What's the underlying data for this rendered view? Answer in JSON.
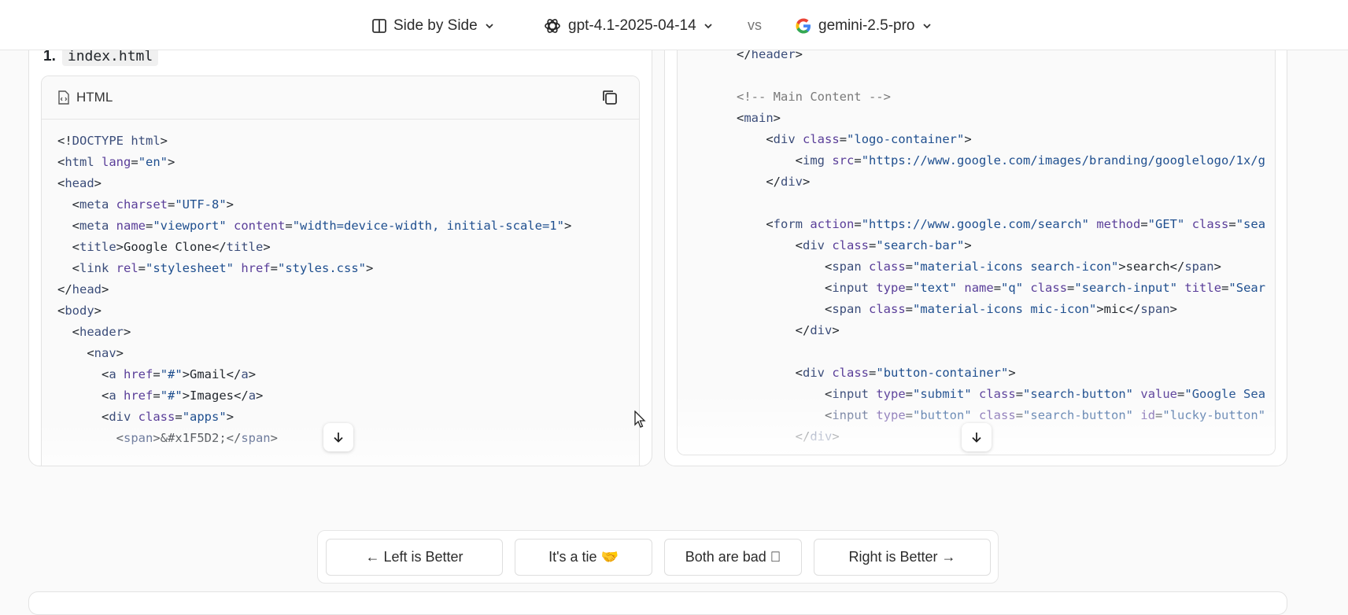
{
  "topbar": {
    "view_mode": "Side by Side",
    "left_model": "gpt-4.1-2025-04-14",
    "vs": "vs",
    "right_model": "gemini-2.5-pro"
  },
  "left_panel": {
    "file_number": "1.",
    "file_name": "index.html",
    "language": "HTML",
    "code_lines": [
      [
        [
          "p",
          "<!"
        ],
        [
          "t",
          "DOCTYPE html"
        ],
        [
          "p",
          ">"
        ]
      ],
      [
        [
          "p",
          "<"
        ],
        [
          "t",
          "html"
        ],
        [
          "p",
          " "
        ],
        [
          "a",
          "lang"
        ],
        [
          "p",
          "="
        ],
        [
          "s",
          "\"en\""
        ],
        [
          "p",
          ">"
        ]
      ],
      [
        [
          "p",
          "<"
        ],
        [
          "t",
          "head"
        ],
        [
          "p",
          ">"
        ]
      ],
      [
        [
          "p",
          "  <"
        ],
        [
          "t",
          "meta"
        ],
        [
          "p",
          " "
        ],
        [
          "a",
          "charset"
        ],
        [
          "p",
          "="
        ],
        [
          "s",
          "\"UTF-8\""
        ],
        [
          "p",
          ">"
        ]
      ],
      [
        [
          "p",
          "  <"
        ],
        [
          "t",
          "meta"
        ],
        [
          "p",
          " "
        ],
        [
          "a",
          "name"
        ],
        [
          "p",
          "="
        ],
        [
          "s",
          "\"viewport\""
        ],
        [
          "p",
          " "
        ],
        [
          "a",
          "content"
        ],
        [
          "p",
          "="
        ],
        [
          "s",
          "\"width=device-width, initial-scale=1\""
        ],
        [
          "p",
          ">"
        ]
      ],
      [
        [
          "p",
          "  <"
        ],
        [
          "t",
          "title"
        ],
        [
          "p",
          ">Google Clone</"
        ],
        [
          "t",
          "title"
        ],
        [
          "p",
          ">"
        ]
      ],
      [
        [
          "p",
          "  <"
        ],
        [
          "t",
          "link"
        ],
        [
          "p",
          " "
        ],
        [
          "a",
          "rel"
        ],
        [
          "p",
          "="
        ],
        [
          "s",
          "\"stylesheet\""
        ],
        [
          "p",
          " "
        ],
        [
          "a",
          "href"
        ],
        [
          "p",
          "="
        ],
        [
          "s",
          "\"styles.css\""
        ],
        [
          "p",
          ">"
        ]
      ],
      [
        [
          "p",
          "</"
        ],
        [
          "t",
          "head"
        ],
        [
          "p",
          ">"
        ]
      ],
      [
        [
          "p",
          "<"
        ],
        [
          "t",
          "body"
        ],
        [
          "p",
          ">"
        ]
      ],
      [
        [
          "p",
          "  <"
        ],
        [
          "t",
          "header"
        ],
        [
          "p",
          ">"
        ]
      ],
      [
        [
          "p",
          "    <"
        ],
        [
          "t",
          "nav"
        ],
        [
          "p",
          ">"
        ]
      ],
      [
        [
          "p",
          "      <"
        ],
        [
          "t",
          "a"
        ],
        [
          "p",
          " "
        ],
        [
          "a",
          "href"
        ],
        [
          "p",
          "="
        ],
        [
          "s",
          "\"#\""
        ],
        [
          "p",
          ">Gmail</"
        ],
        [
          "t",
          "a"
        ],
        [
          "p",
          ">"
        ]
      ],
      [
        [
          "p",
          "      <"
        ],
        [
          "t",
          "a"
        ],
        [
          "p",
          " "
        ],
        [
          "a",
          "href"
        ],
        [
          "p",
          "="
        ],
        [
          "s",
          "\"#\""
        ],
        [
          "p",
          ">Images</"
        ],
        [
          "t",
          "a"
        ],
        [
          "p",
          ">"
        ]
      ],
      [
        [
          "p",
          "      <"
        ],
        [
          "t",
          "div"
        ],
        [
          "p",
          " "
        ],
        [
          "a",
          "class"
        ],
        [
          "p",
          "="
        ],
        [
          "s",
          "\"apps\""
        ],
        [
          "p",
          ">"
        ]
      ],
      [
        [
          "p",
          "        <"
        ],
        [
          "t",
          "span"
        ],
        [
          "p",
          ">&#x1F5D2;</"
        ],
        [
          "t",
          "span"
        ],
        [
          "p",
          ">"
        ]
      ]
    ]
  },
  "right_panel": {
    "code_lines": [
      [
        [
          "p",
          "</"
        ],
        [
          "t",
          "header"
        ],
        [
          "p",
          ">"
        ]
      ],
      [
        [
          "p",
          ""
        ]
      ],
      [
        [
          "c",
          "<!-- Main Content -->"
        ]
      ],
      [
        [
          "p",
          "<"
        ],
        [
          "t",
          "main"
        ],
        [
          "p",
          ">"
        ]
      ],
      [
        [
          "p",
          "    <"
        ],
        [
          "t",
          "div"
        ],
        [
          "p",
          " "
        ],
        [
          "a",
          "class"
        ],
        [
          "p",
          "="
        ],
        [
          "s",
          "\"logo-container\""
        ],
        [
          "p",
          ">"
        ]
      ],
      [
        [
          "p",
          "        <"
        ],
        [
          "t",
          "img"
        ],
        [
          "p",
          " "
        ],
        [
          "a",
          "src"
        ],
        [
          "p",
          "="
        ],
        [
          "s",
          "\"https://www.google.com/images/branding/googlelogo/1x/g"
        ]
      ],
      [
        [
          "p",
          "    </"
        ],
        [
          "t",
          "div"
        ],
        [
          "p",
          ">"
        ]
      ],
      [
        [
          "p",
          ""
        ]
      ],
      [
        [
          "p",
          "    <"
        ],
        [
          "t",
          "form"
        ],
        [
          "p",
          " "
        ],
        [
          "a",
          "action"
        ],
        [
          "p",
          "="
        ],
        [
          "s",
          "\"https://www.google.com/search\""
        ],
        [
          "p",
          " "
        ],
        [
          "a",
          "method"
        ],
        [
          "p",
          "="
        ],
        [
          "s",
          "\"GET\""
        ],
        [
          "p",
          " "
        ],
        [
          "a",
          "class"
        ],
        [
          "p",
          "="
        ],
        [
          "s",
          "\"sea"
        ]
      ],
      [
        [
          "p",
          "        <"
        ],
        [
          "t",
          "div"
        ],
        [
          "p",
          " "
        ],
        [
          "a",
          "class"
        ],
        [
          "p",
          "="
        ],
        [
          "s",
          "\"search-bar\""
        ],
        [
          "p",
          ">"
        ]
      ],
      [
        [
          "p",
          "            <"
        ],
        [
          "t",
          "span"
        ],
        [
          "p",
          " "
        ],
        [
          "a",
          "class"
        ],
        [
          "p",
          "="
        ],
        [
          "s",
          "\"material-icons search-icon\""
        ],
        [
          "p",
          ">search</"
        ],
        [
          "t",
          "span"
        ],
        [
          "p",
          ">"
        ]
      ],
      [
        [
          "p",
          "            <"
        ],
        [
          "t",
          "input"
        ],
        [
          "p",
          " "
        ],
        [
          "a",
          "type"
        ],
        [
          "p",
          "="
        ],
        [
          "s",
          "\"text\""
        ],
        [
          "p",
          " "
        ],
        [
          "a",
          "name"
        ],
        [
          "p",
          "="
        ],
        [
          "s",
          "\"q\""
        ],
        [
          "p",
          " "
        ],
        [
          "a",
          "class"
        ],
        [
          "p",
          "="
        ],
        [
          "s",
          "\"search-input\""
        ],
        [
          "p",
          " "
        ],
        [
          "a",
          "title"
        ],
        [
          "p",
          "="
        ],
        [
          "s",
          "\"Sear"
        ]
      ],
      [
        [
          "p",
          "            <"
        ],
        [
          "t",
          "span"
        ],
        [
          "p",
          " "
        ],
        [
          "a",
          "class"
        ],
        [
          "p",
          "="
        ],
        [
          "s",
          "\"material-icons mic-icon\""
        ],
        [
          "p",
          ">mic</"
        ],
        [
          "t",
          "span"
        ],
        [
          "p",
          ">"
        ]
      ],
      [
        [
          "p",
          "        </"
        ],
        [
          "t",
          "div"
        ],
        [
          "p",
          ">"
        ]
      ],
      [
        [
          "p",
          ""
        ]
      ],
      [
        [
          "p",
          "        <"
        ],
        [
          "t",
          "div"
        ],
        [
          "p",
          " "
        ],
        [
          "a",
          "class"
        ],
        [
          "p",
          "="
        ],
        [
          "s",
          "\"button-container\""
        ],
        [
          "p",
          ">"
        ]
      ],
      [
        [
          "p",
          "            <"
        ],
        [
          "t",
          "input"
        ],
        [
          "p",
          " "
        ],
        [
          "a",
          "type"
        ],
        [
          "p",
          "="
        ],
        [
          "s",
          "\"submit\""
        ],
        [
          "p",
          " "
        ],
        [
          "a",
          "class"
        ],
        [
          "p",
          "="
        ],
        [
          "s",
          "\"search-button\""
        ],
        [
          "p",
          " "
        ],
        [
          "a",
          "value"
        ],
        [
          "p",
          "="
        ],
        [
          "s",
          "\"Google Sea"
        ]
      ],
      [
        [
          "p",
          "            <"
        ],
        [
          "t",
          "input"
        ],
        [
          "p",
          " "
        ],
        [
          "a",
          "type"
        ],
        [
          "p",
          "="
        ],
        [
          "s",
          "\"button\""
        ],
        [
          "p",
          " "
        ],
        [
          "a",
          "class"
        ],
        [
          "p",
          "="
        ],
        [
          "s",
          "\"search-button\""
        ],
        [
          "p",
          " "
        ],
        [
          "a",
          "id"
        ],
        [
          "p",
          "="
        ],
        [
          "s",
          "\"lucky-button\""
        ]
      ],
      [
        [
          "p",
          "        </"
        ],
        [
          "t",
          "div"
        ],
        [
          "p",
          ">"
        ]
      ]
    ]
  },
  "vote": {
    "left_better": "← Left is Better",
    "tie": "It's a tie 🤝",
    "both_bad": "Both are bad ⃠",
    "right_better": "Right is Better →"
  },
  "colors": {
    "punct": "#24292f",
    "tag": "#3b4d7a",
    "attr": "#5a3e99",
    "string": "#1f4f8f",
    "comment": "#7a7a7a"
  }
}
